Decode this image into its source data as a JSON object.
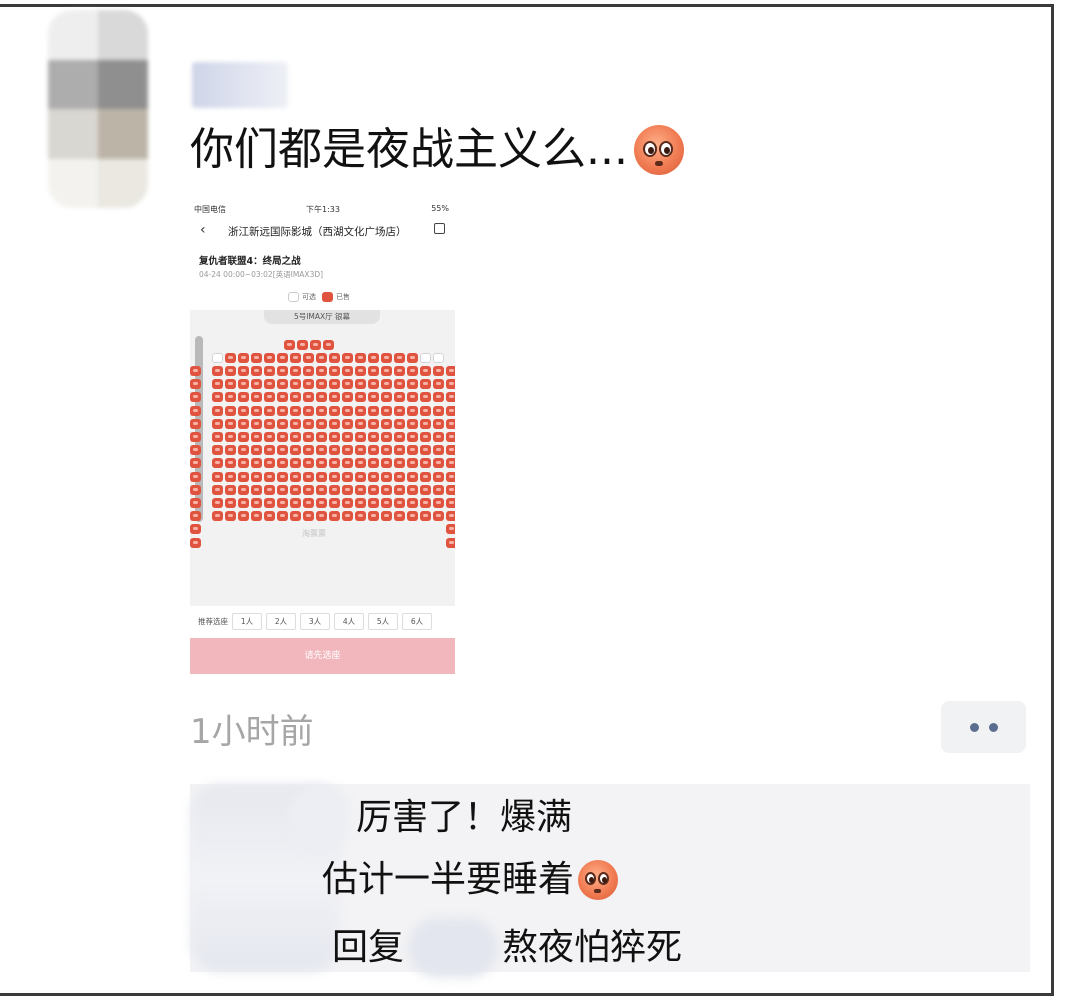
{
  "post": {
    "text": "你们都是夜战主义么...",
    "emoji": "pleading-face-emoji"
  },
  "screenshot": {
    "status": {
      "carrier": "中国电信",
      "time": "下午1:33",
      "battery": "55%"
    },
    "cinema_title": "浙江新远国际影城（西湖文化广场店）",
    "movie_title": "复仇者联盟4：终局之战",
    "movie_time": "04-24 00:00~03:02[英语IMAX3D]",
    "legend": {
      "available": "可选",
      "sold": "已售"
    },
    "screen_label": "5号IMAX厅 银幕",
    "watermark": "淘票票",
    "recommend_label": "推荐选座",
    "recommend_options": [
      "1人",
      "2人",
      "3人",
      "4人",
      "5人",
      "6人"
    ],
    "cta": "请先选座"
  },
  "meta": {
    "timestamp": "1小时前"
  },
  "comments": [
    {
      "text": "厉害了！爆满",
      "emoji": null
    },
    {
      "text": "估计一半要睡着",
      "emoji": "pleading-face-emoji"
    },
    {
      "reply_label": "回复",
      "text": "熬夜怕猝死",
      "emoji": null
    }
  ],
  "colors": {
    "seat_sold": "#e0533e",
    "cta_pink": "#f1b7bd",
    "link_blue": "#5c6e90",
    "timestamp_gray": "#a6a6a6"
  }
}
